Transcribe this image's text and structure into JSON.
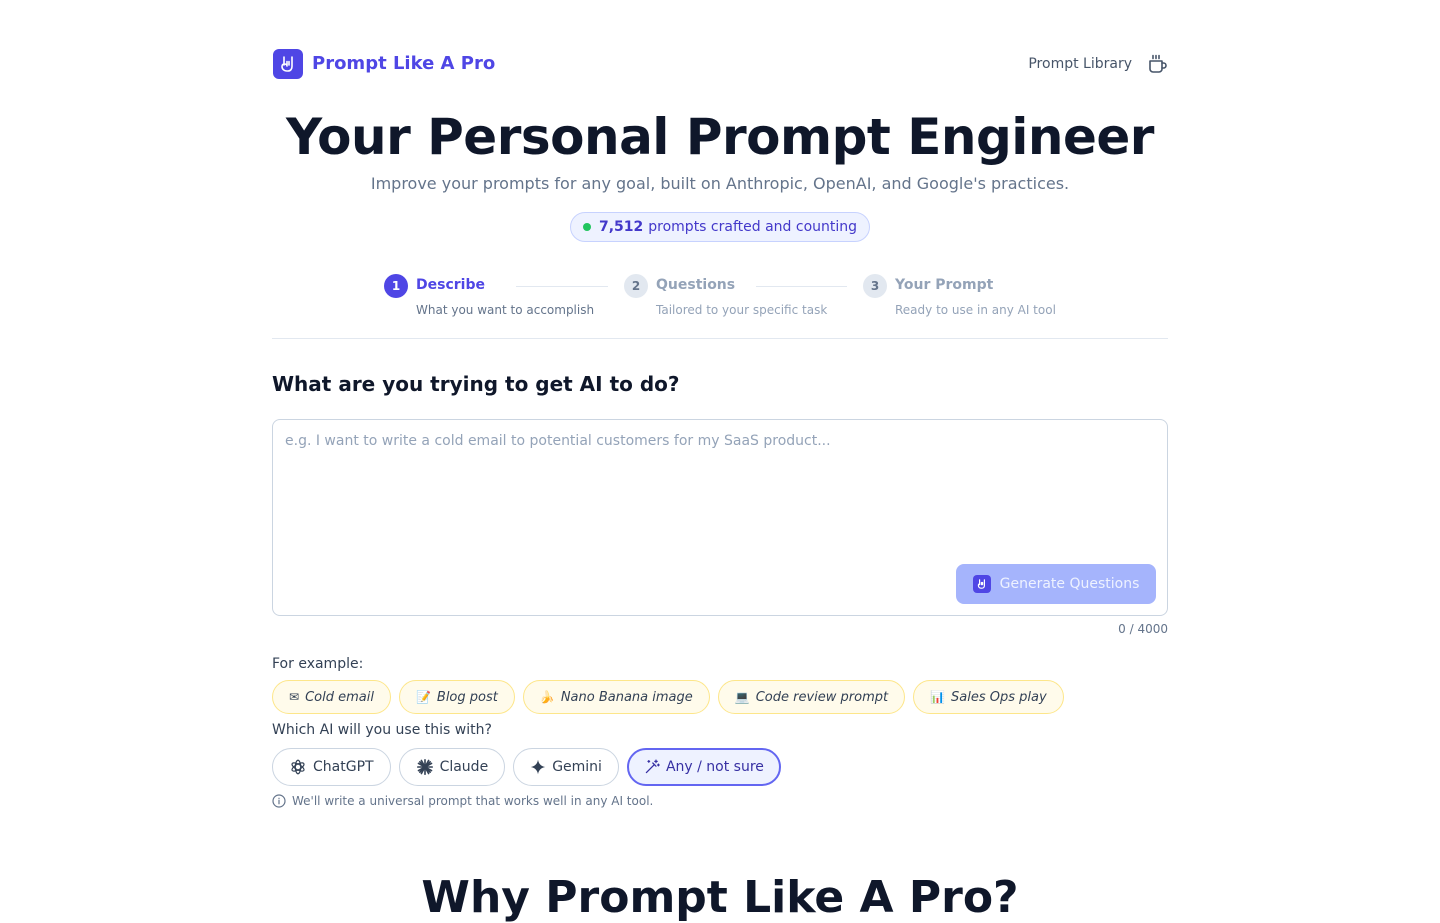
{
  "header": {
    "brand": "Prompt Like A Pro",
    "library_link": "Prompt Library"
  },
  "hero": {
    "title": "Your Personal Prompt Engineer",
    "subtitle": "Improve your prompts for any goal, built on Anthropic, OpenAI, and Google's practices.",
    "counter_value": "7,512",
    "counter_text": "prompts crafted and counting"
  },
  "steps": [
    {
      "num": "1",
      "label": "Describe",
      "desc": "What you want to accomplish"
    },
    {
      "num": "2",
      "label": "Questions",
      "desc": "Tailored to your specific task"
    },
    {
      "num": "3",
      "label": "Your Prompt",
      "desc": "Ready to use in any AI tool"
    }
  ],
  "form": {
    "question": "What are you trying to get AI to do?",
    "placeholder": "e.g. I want to write a cold email to potential customers for my SaaS product...",
    "generate_label": "Generate Questions",
    "char_count": "0 / 4000",
    "examples_label": "For example:",
    "examples": [
      {
        "emoji": "✉",
        "label": "Cold email"
      },
      {
        "emoji": "📝",
        "label": "Blog post"
      },
      {
        "emoji": "🍌",
        "label": "Nano Banana image"
      },
      {
        "emoji": "💻",
        "label": "Code review prompt"
      },
      {
        "emoji": "📊",
        "label": "Sales Ops play"
      }
    ],
    "ai_label": "Which AI will you use this with?",
    "ai_options": [
      "ChatGPT",
      "Claude",
      "Gemini",
      "Any / not sure"
    ],
    "ai_selected": "Any / not sure",
    "ai_note": "We'll write a universal prompt that works well in any AI tool."
  },
  "why_title": "Why Prompt Like A Pro?",
  "colors": {
    "accent": "#4f46e5",
    "accent_light": "#a5b4fc",
    "counter_dot": "#22c55e",
    "chip_bg": "#fffbeb"
  }
}
